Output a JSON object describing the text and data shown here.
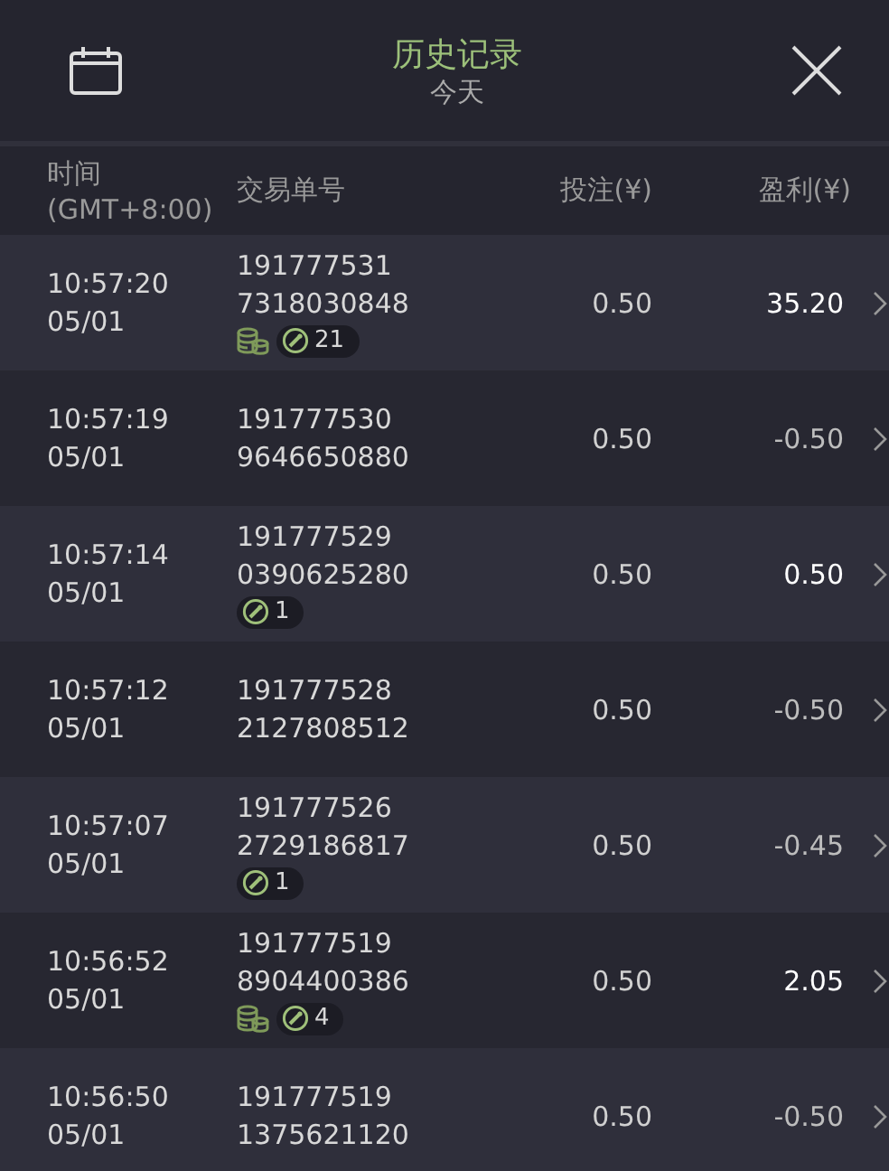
{
  "header": {
    "title": "历史记录",
    "subtitle": "今天"
  },
  "columns": [
    {
      "lines": [
        "时间",
        "(GMT+8:00)"
      ]
    },
    {
      "lines": [
        "交易单号"
      ]
    },
    {
      "lines": [
        "投注(¥)"
      ]
    },
    {
      "lines": [
        "盈利(¥)"
      ]
    }
  ],
  "rows": [
    {
      "time": "10:57:20",
      "date": "05/01",
      "id": [
        "191777531",
        "7318030848"
      ],
      "coins": true,
      "count": "21",
      "stake": "0.50",
      "profit": "35.20",
      "win": true
    },
    {
      "time": "10:57:19",
      "date": "05/01",
      "id": [
        "191777530",
        "9646650880"
      ],
      "coins": false,
      "stake": "0.50",
      "profit": "-0.50",
      "win": false
    },
    {
      "time": "10:57:14",
      "date": "05/01",
      "id": [
        "191777529",
        "0390625280"
      ],
      "coins": false,
      "count": "1",
      "stake": "0.50",
      "profit": "0.50",
      "win": true
    },
    {
      "time": "10:57:12",
      "date": "05/01",
      "id": [
        "191777528",
        "2127808512"
      ],
      "coins": false,
      "stake": "0.50",
      "profit": "-0.50",
      "win": false
    },
    {
      "time": "10:57:07",
      "date": "05/01",
      "id": [
        "191777526",
        "2729186817"
      ],
      "coins": false,
      "count": "1",
      "stake": "0.50",
      "profit": "-0.45",
      "win": false
    },
    {
      "time": "10:56:52",
      "date": "05/01",
      "id": [
        "191777519",
        "8904400386"
      ],
      "coins": true,
      "count": "4",
      "stake": "0.50",
      "profit": "2.05",
      "win": true
    },
    {
      "time": "10:56:50",
      "date": "05/01",
      "id": [
        "191777519",
        "1375621120"
      ],
      "coins": false,
      "stake": "0.50",
      "profit": "-0.50",
      "win": false
    }
  ]
}
